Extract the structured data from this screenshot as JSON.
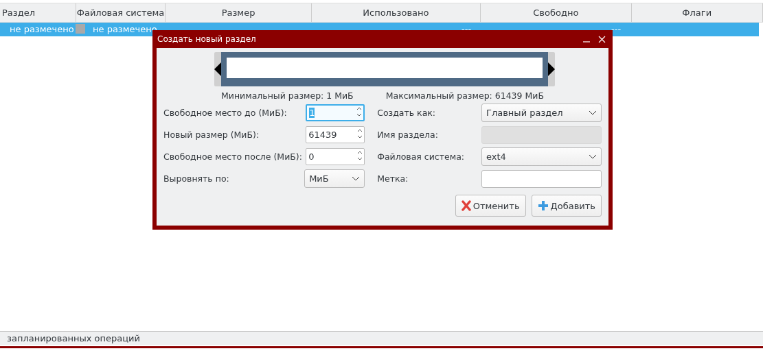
{
  "table": {
    "columns": [
      "Раздел",
      "Файловая система",
      "Размер",
      "Использовано",
      "Свободно",
      "Флаги"
    ],
    "rows": [
      {
        "selected": true,
        "partition": "не размечено",
        "color": "#a9a9a9",
        "filesystem": "не размечено",
        "used": "---",
        "free": "---"
      }
    ]
  },
  "dialog": {
    "title": "Создать новый раздел",
    "min_label": "Минимальный размер: 1 МиБ",
    "max_label": "Максимальный размер: 61439 МиБ",
    "left_fields": [
      {
        "label": "Свободное место до (МиБ):",
        "kind": "spin",
        "value": "1",
        "focused": true
      },
      {
        "label": "Новый размер (МиБ):",
        "kind": "spin",
        "value": "61439",
        "focused": false
      },
      {
        "label": "Свободное место после (МиБ):",
        "kind": "spin",
        "value": "0",
        "focused": false
      },
      {
        "label": "Выровнять по:",
        "kind": "select",
        "value": "МиБ"
      }
    ],
    "right_fields": [
      {
        "label": "Создать как:",
        "kind": "select",
        "value": "Главный раздел"
      },
      {
        "label": "Имя раздела:",
        "kind": "text",
        "disabled": true
      },
      {
        "label": "Файловая система:",
        "kind": "select",
        "value": "ext4"
      },
      {
        "label": "Метка:",
        "kind": "text",
        "disabled": false
      }
    ],
    "buttons": [
      {
        "label": "Отменить",
        "kind": "cancel"
      },
      {
        "label": "Добавить",
        "kind": "add"
      }
    ]
  },
  "status_bar": "запланированных операций"
}
